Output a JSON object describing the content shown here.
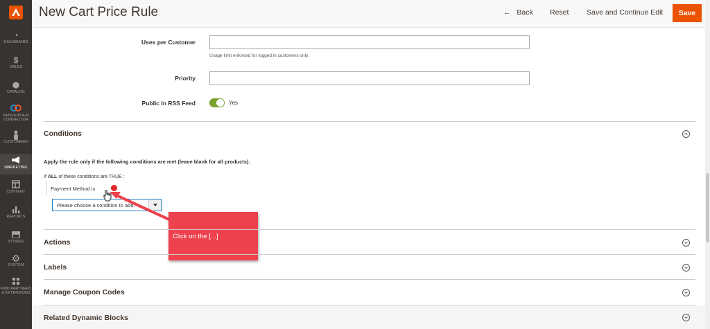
{
  "header": {
    "title": "New Cart Price Rule",
    "back_label": "Back",
    "reset_label": "Reset",
    "save_continue_label": "Save and Continue Edit",
    "save_label": "Save"
  },
  "sidebar": {
    "items": [
      {
        "label": "DASHBOARD",
        "icon": "dashboard-icon"
      },
      {
        "label": "SALES",
        "icon": "dollar-icon"
      },
      {
        "label": "CATALOG",
        "icon": "box-icon"
      },
      {
        "label": "KENSIUM A-M",
        "label2": "CONNECTOR",
        "icon": "connector-icon"
      },
      {
        "label": "CUSTOMERS",
        "icon": "person-icon"
      },
      {
        "label": "MARKETING",
        "icon": "megaphone-icon"
      },
      {
        "label": "CONTENT",
        "icon": "layout-icon"
      },
      {
        "label": "REPORTS",
        "icon": "bar-chart-icon"
      },
      {
        "label": "STORES",
        "icon": "store-icon"
      },
      {
        "label": "SYSTEM",
        "icon": "gear-icon"
      },
      {
        "label": "FIND PARTNERS",
        "label2": "& EXTENSIONS",
        "icon": "extensions-icon"
      }
    ]
  },
  "form": {
    "uses_per_customer_label": "Uses per Customer",
    "uses_per_customer_value": "",
    "uses_note": "Usage limit enforced for logged in customers only.",
    "priority_label": "Priority",
    "priority_value": "",
    "rss_label": "Public In RSS Feed",
    "rss_value": "Yes"
  },
  "conditions": {
    "title": "Conditions",
    "description": "Apply the rule only if the following conditions are met (leave blank for all products).",
    "if_prefix": "If",
    "if_all": "ALL",
    "if_suffix": "of these conditions are TRUE :",
    "condition_text": "Payment Method  is",
    "select_placeholder": "Please choose a condition to add."
  },
  "sections": {
    "actions": "Actions",
    "labels": "Labels",
    "coupon": "Manage Coupon Codes",
    "related": "Related Dynamic Blocks"
  },
  "callout": {
    "text": "Click on the [...]"
  },
  "colors": {
    "accent": "#eb5202",
    "sidebar": "#373330",
    "toggle_on": "#79a22e",
    "callout": "#ed424d"
  }
}
